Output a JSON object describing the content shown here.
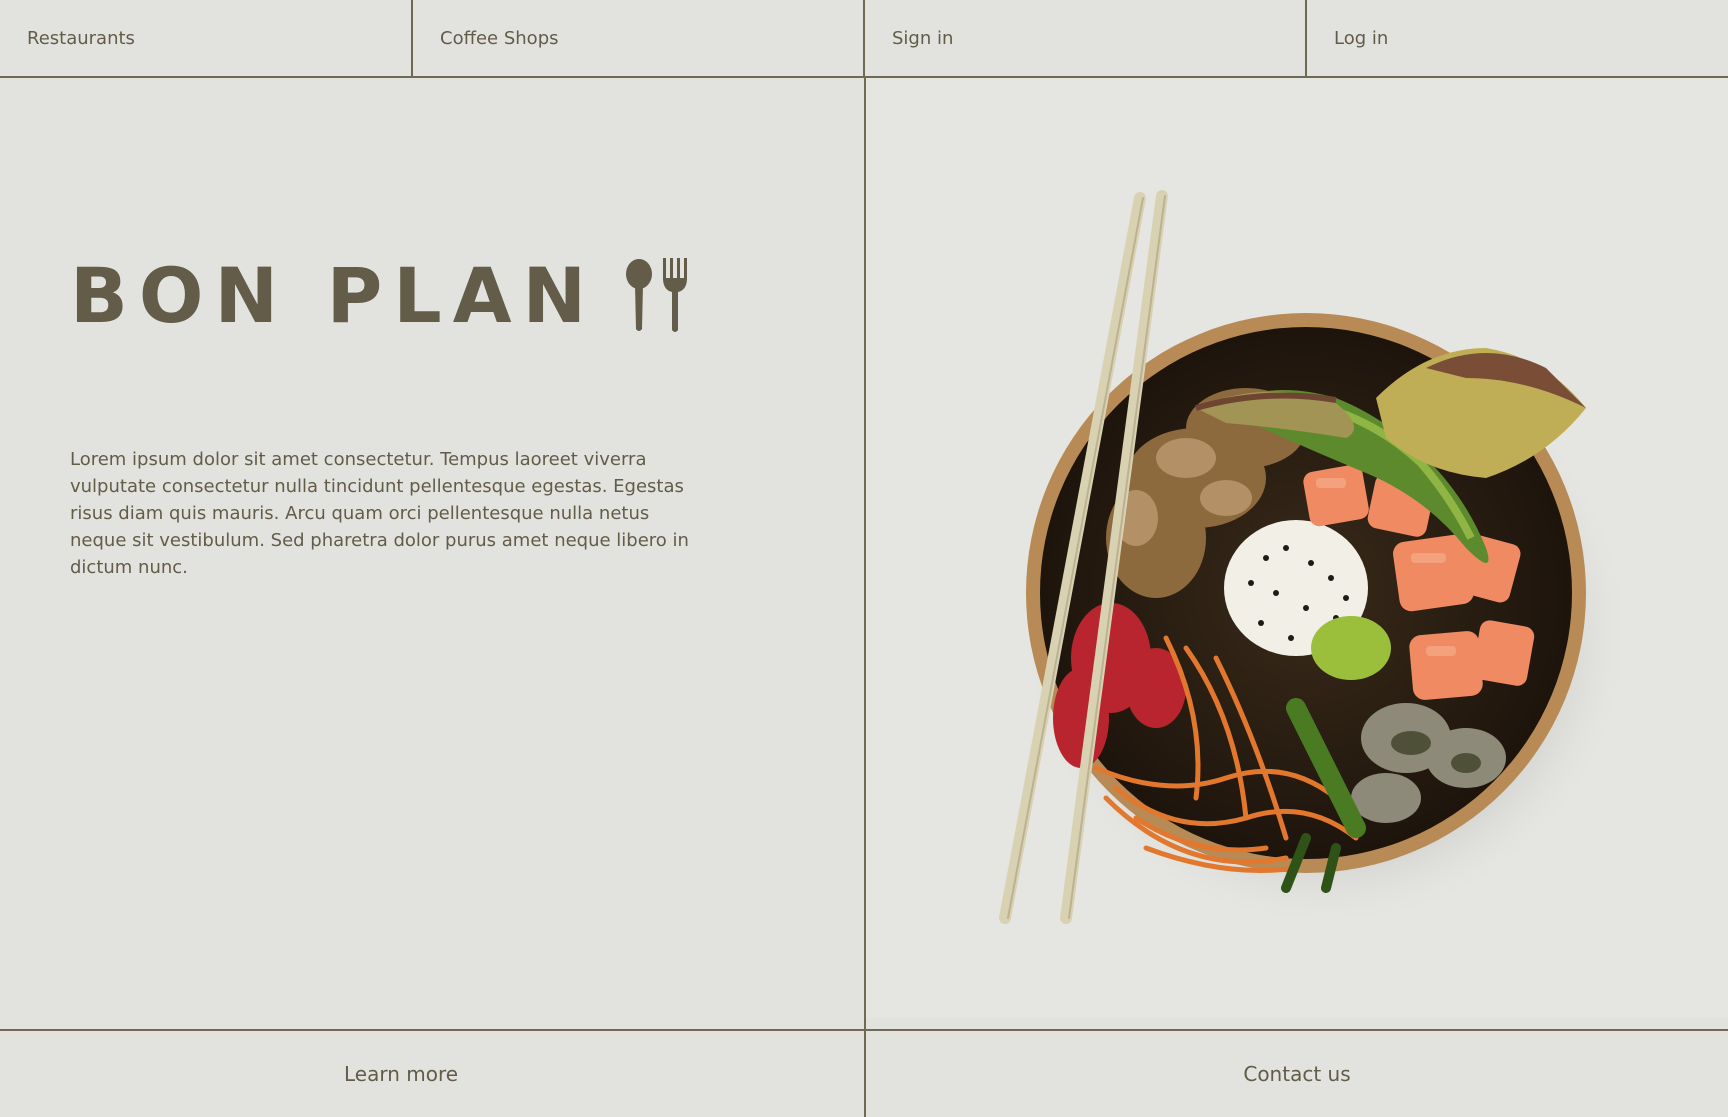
{
  "nav": {
    "items": [
      {
        "label": "Restaurants"
      },
      {
        "label": "Coffee Shops"
      },
      {
        "label": "Sign in"
      },
      {
        "label": "Log in"
      }
    ]
  },
  "hero": {
    "brand": "BON PLAN",
    "brand_icon": "spoon-fork-icon",
    "description": "Lorem ipsum dolor sit amet consectetur. Tempus laoreet viverra vulputate consectetur nulla tincidunt pellentesque egestas. Egestas risus diam quis mauris. Arcu quam orci pellentesque nulla netus neque sit vestibulum. Sed pharetra dolor purus amet neque libero in dictum nunc."
  },
  "footer": {
    "learn_more": "Learn more",
    "contact_us": "Contact us"
  },
  "colors": {
    "background": "#e2e2df",
    "text": "#625c48",
    "rule": "#6f6a52"
  }
}
